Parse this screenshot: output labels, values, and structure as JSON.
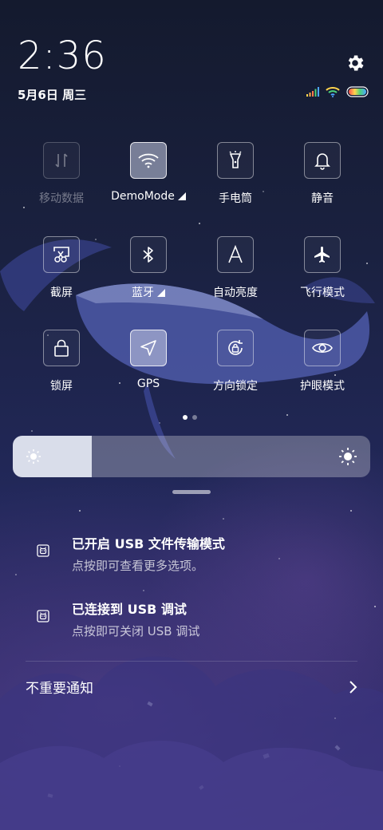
{
  "status": {
    "time": "2:36",
    "date": "5月6日 周三",
    "icons": [
      "signal-icon",
      "wifi-icon",
      "battery-icon"
    ]
  },
  "settings_icon": "gear-icon",
  "tiles": [
    {
      "label": "移动数据",
      "icon": "mobile-data-icon",
      "state": "disabled"
    },
    {
      "label": "DemoMode",
      "icon": "wifi-icon",
      "state": "active",
      "has_arrow": true
    },
    {
      "label": "手电筒",
      "icon": "flashlight-icon",
      "state": "off"
    },
    {
      "label": "静音",
      "icon": "bell-icon",
      "state": "off"
    },
    {
      "label": "截屏",
      "icon": "screenshot-icon",
      "state": "off"
    },
    {
      "label": "蓝牙",
      "icon": "bluetooth-icon",
      "state": "off",
      "has_arrow": true
    },
    {
      "label": "自动亮度",
      "icon": "auto-brightness-icon",
      "state": "off"
    },
    {
      "label": "飞行模式",
      "icon": "airplane-icon",
      "state": "off"
    },
    {
      "label": "锁屏",
      "icon": "lock-icon",
      "state": "off"
    },
    {
      "label": "GPS",
      "icon": "location-arrow-icon",
      "state": "active"
    },
    {
      "label": "方向锁定",
      "icon": "rotation-lock-icon",
      "state": "off"
    },
    {
      "label": "护眼模式",
      "icon": "eye-icon",
      "state": "off"
    }
  ],
  "pager": {
    "pages": 2,
    "current": 1
  },
  "brightness": {
    "level": 0.22
  },
  "notifications": [
    {
      "title": "已开启 USB 文件传输模式",
      "subtitle": "点按即可查看更多选项。",
      "icon": "android-debug-icon"
    },
    {
      "title": "已连接到 USB 调试",
      "subtitle": "点按即可关闭 USB 调试",
      "icon": "android-debug-icon"
    }
  ],
  "unimportant": {
    "label": "不重要通知",
    "icon": "chevron-right-icon"
  },
  "colors": {
    "active_tile": "#c8cde6",
    "battery_gradient": [
      "#ff4d4d",
      "#ffd54d",
      "#4dd27a",
      "#4da6ff"
    ]
  }
}
